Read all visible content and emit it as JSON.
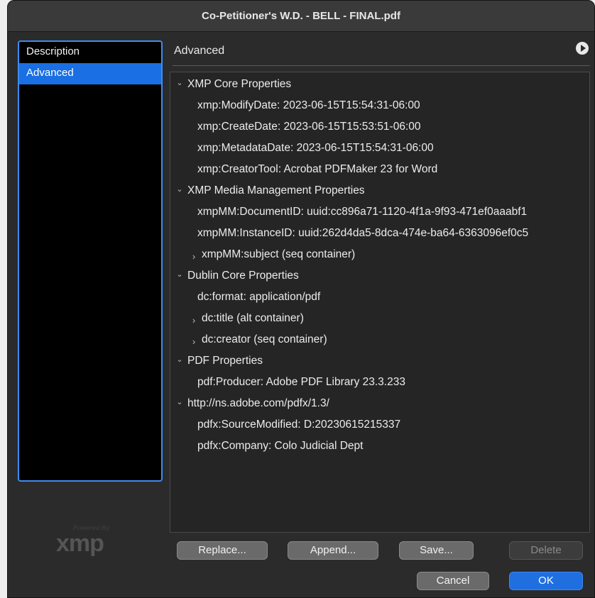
{
  "window": {
    "title": "Co-Petitioner's W.D. - BELL - FINAL.pdf"
  },
  "sidebar": {
    "items": [
      {
        "label": "Description",
        "selected": false
      },
      {
        "label": "Advanced",
        "selected": true
      }
    ]
  },
  "logo": {
    "powered": "Powered By",
    "brand": "xmp"
  },
  "panel": {
    "title": "Advanced",
    "menu_icon": "play-circle-icon"
  },
  "tree": {
    "rows": [
      {
        "label": "XMP Core Properties",
        "level": 0,
        "twisty": "expanded"
      },
      {
        "label": "xmp:ModifyDate: 2023-06-15T15:54:31-06:00",
        "level": 1,
        "twisty": "none"
      },
      {
        "label": "xmp:CreateDate: 2023-06-15T15:53:51-06:00",
        "level": 1,
        "twisty": "none"
      },
      {
        "label": "xmp:MetadataDate: 2023-06-15T15:54:31-06:00",
        "level": 1,
        "twisty": "none"
      },
      {
        "label": "xmp:CreatorTool: Acrobat PDFMaker 23 for Word",
        "level": 1,
        "twisty": "none"
      },
      {
        "label": "XMP Media Management Properties",
        "level": 0,
        "twisty": "expanded"
      },
      {
        "label": "xmpMM:DocumentID: uuid:cc896a71-1120-4f1a-9f93-471ef0aaabf1",
        "level": 1,
        "twisty": "none"
      },
      {
        "label": "xmpMM:InstanceID: uuid:262d4da5-8dca-474e-ba64-6363096ef0c5",
        "level": 1,
        "twisty": "none"
      },
      {
        "label": "xmpMM:subject (seq container)",
        "level": 1,
        "twisty": "collapsed"
      },
      {
        "label": "Dublin Core Properties",
        "level": 0,
        "twisty": "expanded"
      },
      {
        "label": "dc:format: application/pdf",
        "level": 1,
        "twisty": "none"
      },
      {
        "label": "dc:title (alt container)",
        "level": 1,
        "twisty": "collapsed"
      },
      {
        "label": "dc:creator (seq container)",
        "level": 1,
        "twisty": "collapsed"
      },
      {
        "label": "PDF Properties",
        "level": 0,
        "twisty": "expanded"
      },
      {
        "label": "pdf:Producer: Adobe PDF Library 23.3.233",
        "level": 1,
        "twisty": "none"
      },
      {
        "label": "http://ns.adobe.com/pdfx/1.3/",
        "level": 0,
        "twisty": "expanded"
      },
      {
        "label": "pdfx:SourceModified: D:20230615215337",
        "level": 1,
        "twisty": "none"
      },
      {
        "label": "pdfx:Company: Colo Judicial Dept",
        "level": 1,
        "twisty": "none"
      }
    ]
  },
  "buttons": {
    "replace": "Replace...",
    "append": "Append...",
    "save": "Save...",
    "delete": "Delete",
    "cancel": "Cancel",
    "ok": "OK"
  },
  "colors": {
    "accent": "#1a6fe2",
    "focus_ring": "#3e8cf0",
    "background": "#2b2b2b"
  }
}
